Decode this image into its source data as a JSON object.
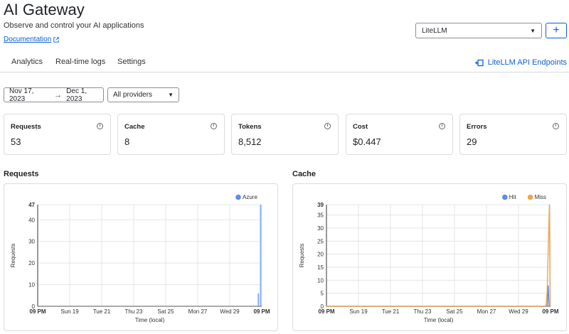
{
  "header": {
    "title": "AI Gateway",
    "subtitle": "Observe and control your AI applications",
    "doc_link": "Documentation"
  },
  "gateway_select": {
    "value": "LiteLLM"
  },
  "add_button": {
    "label": "+"
  },
  "tabs": [
    {
      "label": "Analytics",
      "active": true
    },
    {
      "label": "Real-time logs"
    },
    {
      "label": "Settings"
    }
  ],
  "endpoints_link": "LiteLLM API Endpoints",
  "filters": {
    "date_from": "Nov 17, 2023",
    "date_to": "Dec 1, 2023",
    "provider": "All providers"
  },
  "stats": [
    {
      "label": "Requests",
      "value": "53"
    },
    {
      "label": "Cache",
      "value": "8"
    },
    {
      "label": "Tokens",
      "value": "8,512"
    },
    {
      "label": "Cost",
      "value": "$0.447"
    },
    {
      "label": "Errors",
      "value": "29"
    }
  ],
  "colors": {
    "accent": "#0b5fd6",
    "azure": "#5b8def",
    "hit": "#5b8def",
    "miss": "#f0a54a",
    "border": "#d9dce1"
  },
  "chart_data": [
    {
      "type": "bar",
      "title": "Requests",
      "xlabel": "Time (local)",
      "ylabel": "Requests",
      "x_ticks": [
        "09 PM",
        "Sun 19",
        "Tue 21",
        "Thu 23",
        "Sat 25",
        "Mon 27",
        "Wed 29",
        "09 PM"
      ],
      "y_ticks": [
        0,
        10,
        20,
        30,
        40,
        47
      ],
      "ylim": [
        0,
        47
      ],
      "legend_position": "top-right",
      "grid": true,
      "series": [
        {
          "name": "Azure",
          "color": "#5b8def",
          "points": [
            [
              0.985,
              6
            ],
            [
              0.995,
              47
            ]
          ]
        }
      ]
    },
    {
      "type": "line",
      "title": "Cache",
      "xlabel": "Time (local)",
      "ylabel": "Requests",
      "x_ticks": [
        "09 PM",
        "Sun 19",
        "Tue 21",
        "Thu 23",
        "Sat 25",
        "Mon 27",
        "Wed 29",
        "09 PM"
      ],
      "y_ticks": [
        0,
        5,
        10,
        15,
        20,
        25,
        30,
        35,
        39
      ],
      "ylim": [
        0,
        39
      ],
      "legend_position": "top-right",
      "grid": true,
      "series": [
        {
          "name": "Hit",
          "color": "#5b8def",
          "points": [
            [
              0.99,
              8
            ]
          ]
        },
        {
          "name": "Miss",
          "color": "#f0a54a",
          "points": [
            [
              0.985,
              6
            ],
            [
              0.995,
              39
            ]
          ]
        }
      ]
    }
  ]
}
